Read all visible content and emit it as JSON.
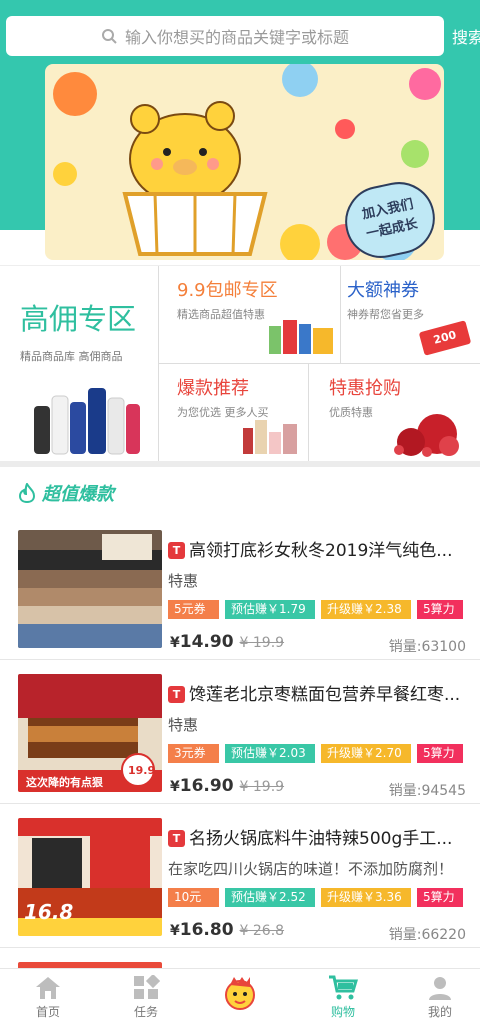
{
  "search": {
    "placeholder": "输入你想买的商品关键字或标题",
    "button": "搜索"
  },
  "banner": {
    "text_line1": "加入我们",
    "text_line2": "一起成长"
  },
  "promo": {
    "big": {
      "title": "高佣专区",
      "subtitle": "精品商品库 高佣商品"
    },
    "c1": {
      "title": "9.9包邮专区",
      "subtitle": "精选商品超值特惠",
      "color": "#f47f3a"
    },
    "c2": {
      "title": "大额神券",
      "subtitle": "神券帮您省更多",
      "badge": "200",
      "color": "#2b62c9"
    },
    "c3": {
      "title": "爆款推荐",
      "subtitle": "为您优选 更多人买",
      "color": "#e8453c"
    },
    "c4": {
      "title": "特惠抢购",
      "subtitle": "优质特惠",
      "color": "#e8453c"
    }
  },
  "section": {
    "title": "超值爆款"
  },
  "products": [
    {
      "title": "高领打底衫女秋冬2019洋气纯色...",
      "desc": "特惠",
      "coupon": "5元券",
      "estimate": "预估赚￥1.79",
      "upgrade": "升级赚￥2.38",
      "power": "5算力",
      "price_symbol": "¥",
      "price": "14.90",
      "old_price": "¥ 19.9",
      "sales": "销量:63100"
    },
    {
      "title": "馋莲老北京枣糕面包营养早餐红枣...",
      "desc": "特惠",
      "coupon": "3元券",
      "estimate": "预估赚￥2.03",
      "upgrade": "升级赚￥2.70",
      "power": "5算力",
      "price_symbol": "¥",
      "price": "16.90",
      "old_price": "¥ 19.9",
      "sales": "销量:94545",
      "thumb_badge": "19.9",
      "thumb_caption": "这次降的有点狠"
    },
    {
      "title": "名扬火锅底料牛油特辣500g手工...",
      "desc": "在家吃四川火锅店的味道！不添加防腐剂！",
      "coupon": "10元券",
      "estimate": "预估赚￥2.52",
      "upgrade": "升级赚￥3.36",
      "power": "5算力",
      "price_symbol": "¥",
      "price": "16.80",
      "old_price": "¥ 26.8",
      "sales": "销量:66220",
      "thumb_badge": "16.8"
    }
  ],
  "tabs": [
    {
      "label": "首页",
      "icon": "home-icon"
    },
    {
      "label": "任务",
      "icon": "grid-icon"
    },
    {
      "label": "",
      "icon": "mascot-icon"
    },
    {
      "label": "购物",
      "icon": "cart-icon",
      "active": true
    },
    {
      "label": "我的",
      "icon": "user-icon"
    }
  ]
}
